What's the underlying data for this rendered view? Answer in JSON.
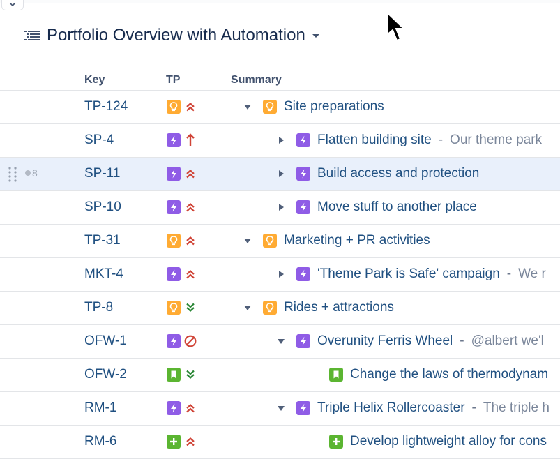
{
  "title": "Portfolio Overview with Automation",
  "columns": {
    "key": "Key",
    "tp": "TP",
    "summary": "Summary"
  },
  "rows": [
    {
      "key": "TP-124",
      "type": "idea",
      "priority": "highest",
      "expand": "down",
      "indent": 0,
      "summary": "Site preparations",
      "desc": ""
    },
    {
      "key": "SP-4",
      "type": "task",
      "priority": "high",
      "expand": "right",
      "indent": 1,
      "summary": "Flatten building site",
      "desc": "Our theme park"
    },
    {
      "key": "SP-11",
      "type": "task",
      "priority": "highest",
      "expand": "right",
      "indent": 1,
      "summary": "Build access and protection",
      "desc": "",
      "selected": true,
      "count": "8"
    },
    {
      "key": "SP-10",
      "type": "task",
      "priority": "highest",
      "expand": "right",
      "indent": 1,
      "summary": "Move stuff to another place",
      "desc": ""
    },
    {
      "key": "TP-31",
      "type": "idea",
      "priority": "highest",
      "expand": "down",
      "indent": 0,
      "summary": "Marketing + PR activities",
      "desc": ""
    },
    {
      "key": "MKT-4",
      "type": "task",
      "priority": "highest",
      "expand": "right",
      "indent": 1,
      "summary": "'Theme Park is Safe' campaign",
      "desc": "We r"
    },
    {
      "key": "TP-8",
      "type": "idea",
      "priority": "lowest",
      "expand": "down",
      "indent": 0,
      "summary": "Rides + attractions",
      "desc": ""
    },
    {
      "key": "OFW-1",
      "type": "task",
      "priority": "blocker",
      "expand": "down",
      "indent": 1,
      "summary": "Overunity Ferris Wheel",
      "desc": "@albert we'l"
    },
    {
      "key": "OFW-2",
      "type": "story",
      "priority": "lowest",
      "expand": "none",
      "indent": 2,
      "summary": "Change the laws of thermodynam",
      "desc": ""
    },
    {
      "key": "RM-1",
      "type": "task",
      "priority": "highest",
      "expand": "down",
      "indent": 1,
      "summary": "Triple Helix Rollercoaster",
      "desc": "The triple h"
    },
    {
      "key": "RM-6",
      "type": "improvement",
      "priority": "highest",
      "expand": "none",
      "indent": 2,
      "summary": "Develop lightweight alloy for cons",
      "desc": ""
    }
  ],
  "icons": {
    "idea": "lightbulb-icon",
    "task": "lightning-bolt-icon",
    "story": "bookmark-icon",
    "improvement": "plus-icon",
    "highest": "double-chevron-up-icon",
    "high": "arrow-up-icon",
    "lowest": "double-chevron-down-icon",
    "blocker": "blocker-icon"
  },
  "colors": {
    "link": "#205081",
    "idea": "#ffab33",
    "task": "#8f5ce6",
    "story": "#5bb531",
    "priority_high": "#d04437",
    "priority_low": "#2a8735",
    "selected_row": "#e9f0fb"
  }
}
